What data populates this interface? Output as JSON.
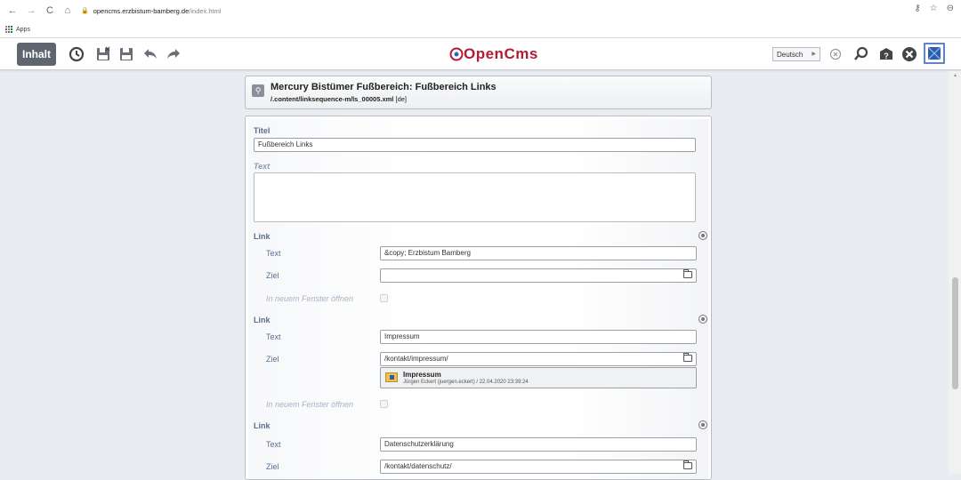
{
  "browser": {
    "nav": {
      "back": "←",
      "forward": "→",
      "reload": "C",
      "home": "⌂"
    },
    "url_host": "opencms.erzbistum-bamberg.de",
    "url_path": "/index.html",
    "apps_label": "Apps"
  },
  "toolbar": {
    "inhalt_label": "Inhalt",
    "logo_text": "OpenCms",
    "language": "Deutsch"
  },
  "editor": {
    "title": "Mercury Bistümer Fußbereich: Fußbereich Links",
    "path": "/.content/linksequence-m/ls_00005.xml",
    "locale": "[de]"
  },
  "form": {
    "titel_label": "Titel",
    "titel_value": "Fußbereich Links",
    "text_label": "Text",
    "links": [
      {
        "section_label": "Link",
        "text_label": "Text",
        "text_value": "&copy; Erzbistum Bamberg",
        "ziel_label": "Ziel",
        "ziel_value": "",
        "window_label": "In neuem Fenster öffnen"
      },
      {
        "section_label": "Link",
        "text_label": "Text",
        "text_value": "Impressum",
        "ziel_label": "Ziel",
        "ziel_value": "/kontakt/impressum/",
        "preview_title": "Impressum",
        "preview_sub": "Jürgen Eckert (juergen.eckert) / 22.04.2020 23:39:24",
        "window_label": "In neuem Fenster öffnen"
      },
      {
        "section_label": "Link",
        "text_label": "Text",
        "text_value": "Datenschutzerklärung",
        "ziel_label": "Ziel",
        "ziel_value": "/kontakt/datenschutz/"
      }
    ]
  },
  "colors": {
    "brand_red": "#b31b34",
    "label_blue": "#5a6e91",
    "inhalt_bg": "#5f6670"
  }
}
